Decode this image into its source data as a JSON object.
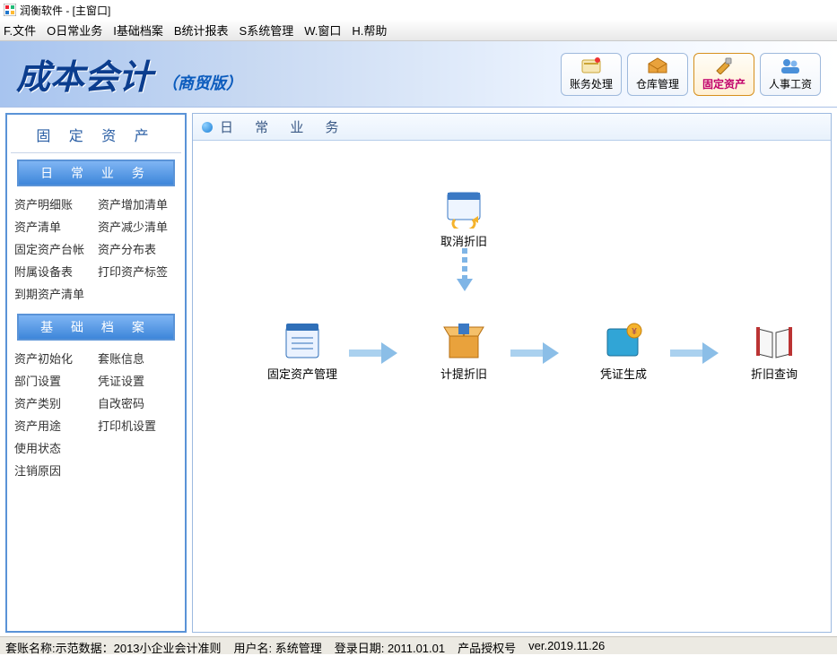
{
  "titlebar": {
    "text": "润衡软件 - [主窗口]"
  },
  "menu": {
    "file": "F.文件",
    "daily": "O日常业务",
    "basic": "I基础档案",
    "report": "B统计报表",
    "system": "S系统管理",
    "window": "W.窗口",
    "help": "H.帮助"
  },
  "banner": {
    "title": "成本会计",
    "subtitle": "（商贸版）",
    "buttons": {
      "b1": "账务处理",
      "b2": "仓库管理",
      "b3": "固定资产",
      "b4": "人事工资"
    }
  },
  "sidebar": {
    "title": "固 定 资 产",
    "panel1": {
      "title": "日 常 业 务",
      "links": {
        "l1": "资产明细账",
        "l2": "资产增加清单",
        "l3": "资产清单",
        "l4": "资产减少清单",
        "l5": "固定资产台帐",
        "l6": "资产分布表",
        "l7": "附属设备表",
        "l8": "打印资产标签",
        "l9": "到期资产清单"
      }
    },
    "panel2": {
      "title": "基 础 档 案",
      "links": {
        "l1": "资产初始化",
        "l2": "套账信息",
        "l3": "部门设置",
        "l4": "凭证设置",
        "l5": "资产类别",
        "l6": "自改密码",
        "l7": "资产用途",
        "l8": "打印机设置",
        "l9": "使用状态",
        "l10": "注销原因"
      }
    }
  },
  "main": {
    "title": "日 常 业 务",
    "nodes": {
      "n1": "取消折旧",
      "n2": "固定资产管理",
      "n3": "计提折旧",
      "n4": "凭证生成",
      "n5": "折旧查询"
    }
  },
  "status": {
    "s1": "套账名称:示范数据：2013小企业会计准则",
    "s2": "用户名: 系统管理",
    "s3": "登录日期: 2011.01.01",
    "s4": "产品授权号",
    "s5": "ver.2019.11.26"
  }
}
